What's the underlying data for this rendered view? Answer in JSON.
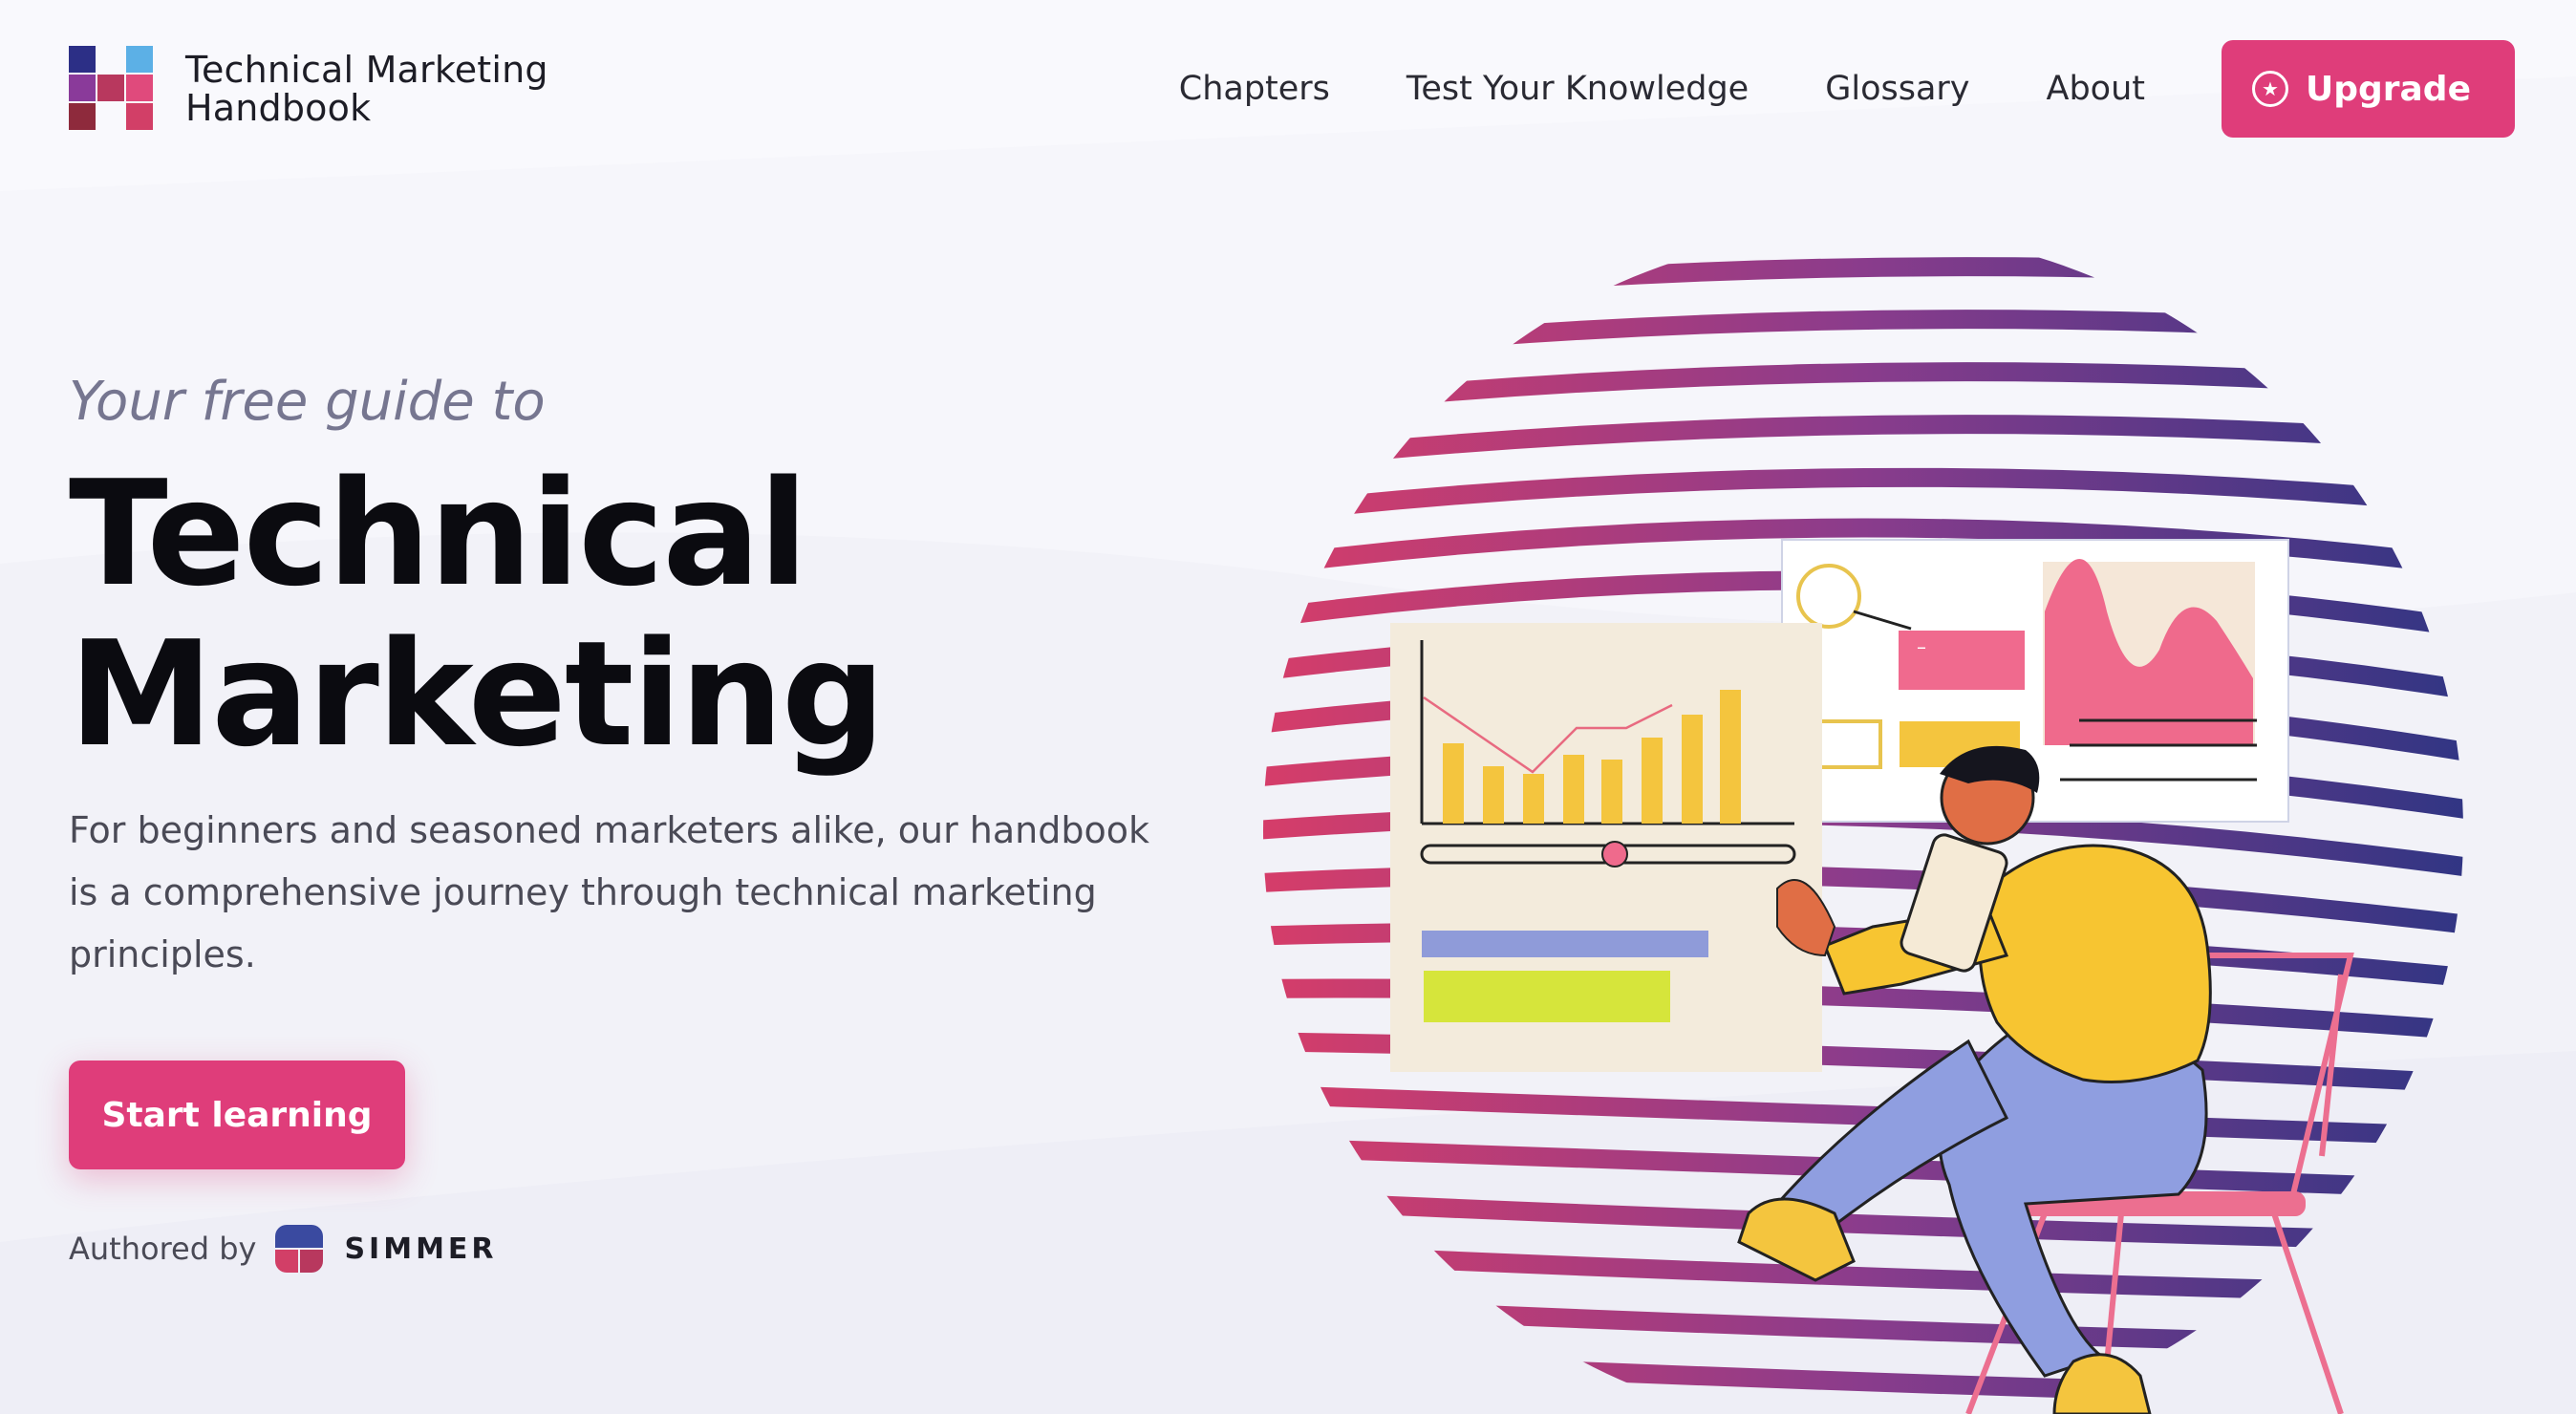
{
  "brand": {
    "line1": "Technical Marketing",
    "line2": "Handbook",
    "colors": {
      "accent": "#df3d7a",
      "navy": "#2c2f86",
      "purple": "#8a3a9a",
      "red": "#d23f67",
      "sky": "#5cb0e6",
      "dark_red": "#8e2a3c"
    }
  },
  "nav": {
    "chapters": "Chapters",
    "test": "Test Your Knowledge",
    "glossary": "Glossary",
    "about": "About",
    "upgrade": "Upgrade",
    "upgrade_icon": "star-circle-icon"
  },
  "hero": {
    "tagline": "Your free guide to",
    "title_line1": "Technical",
    "title_line2": "Marketing",
    "lead": "For beginners and seasoned marketers alike, our handbook is a comprehensive journey through technical marketing principles.",
    "cta": "Start learning",
    "authored_by": "Authored by",
    "author_name": "SIMMER"
  },
  "illustration": {
    "description_icon": "person-with-tablet-illustration",
    "dashboard_minus": "–"
  }
}
